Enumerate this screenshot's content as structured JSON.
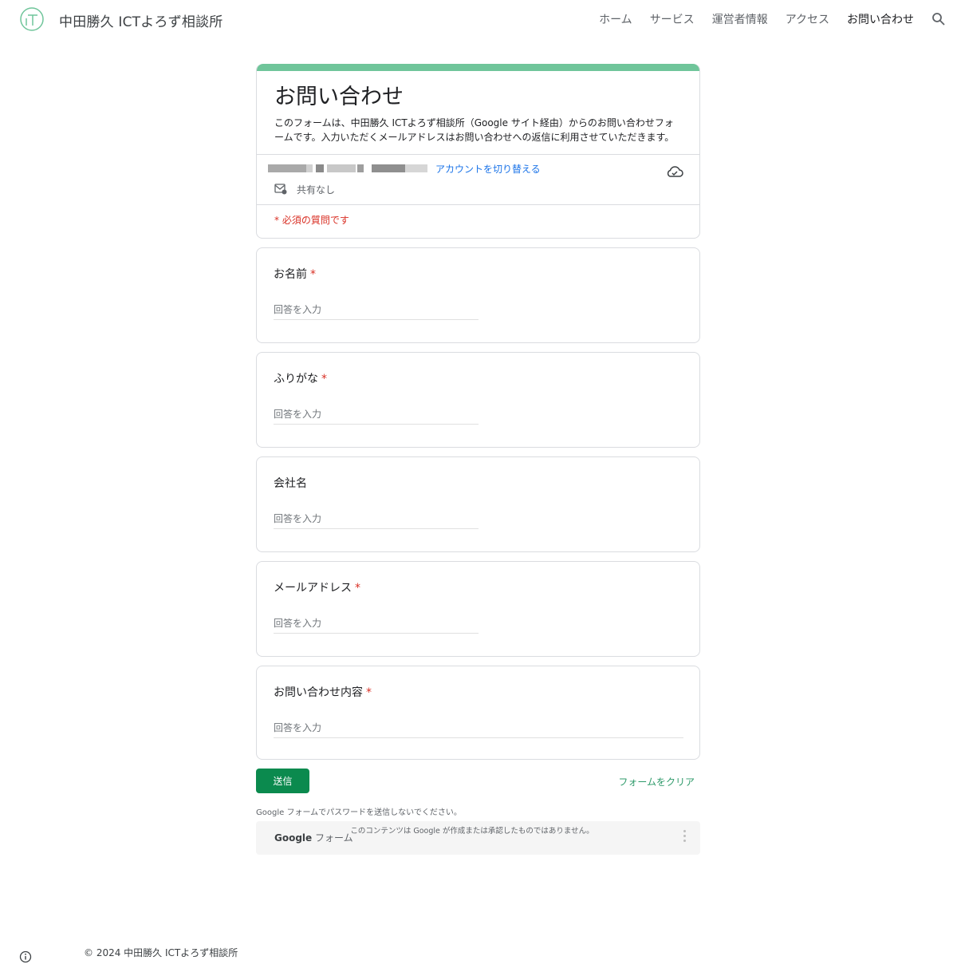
{
  "header": {
    "site_title": "中田勝久 ICTよろず相談所",
    "nav": [
      {
        "label": "ホーム"
      },
      {
        "label": "サービス"
      },
      {
        "label": "運営者情報"
      },
      {
        "label": "アクセス"
      },
      {
        "label": "お問い合わせ"
      }
    ]
  },
  "form": {
    "title": "お問い合わせ",
    "description": "このフォームは、中田勝久 ICTよろず相談所（Google サイト経由）からのお問い合わせフォームです。入力いただくメールアドレスはお問い合わせへの返信に利用させていただきます。",
    "switch_account": "アカウントを切り替える",
    "share_status": "共有なし",
    "required_note": "* 必須の質問です",
    "questions": [
      {
        "label": "お名前",
        "required": "*",
        "placeholder": "回答を入力"
      },
      {
        "label": "ふりがな",
        "required": "*",
        "placeholder": "回答を入力"
      },
      {
        "label": "会社名",
        "required": "",
        "placeholder": "回答を入力"
      },
      {
        "label": "メールアドレス",
        "required": "*",
        "placeholder": "回答を入力"
      },
      {
        "label": "お問い合わせ内容",
        "required": "*",
        "placeholder": "回答を入力"
      }
    ],
    "submit_label": "送信",
    "clear_label": "フォームをクリア",
    "password_note": "Google フォームでパスワードを送信しないでください。",
    "brand_google": "Google",
    "brand_forms": "フォーム",
    "disclaimer": "このコンテンツは Google が作成または承認したものではありません。"
  },
  "footer": {
    "copyright": "© 2024 中田勝久 ICTよろず相談所"
  },
  "colors": {
    "accent_bar": "#6fc59a",
    "submit": "#0b8a4e",
    "link": "#1a73e8",
    "required": "#d93025"
  },
  "icons": [
    "logo-icon",
    "search-icon",
    "cloud-check-icon",
    "mail-share-icon",
    "more-vert-icon",
    "info-icon"
  ]
}
